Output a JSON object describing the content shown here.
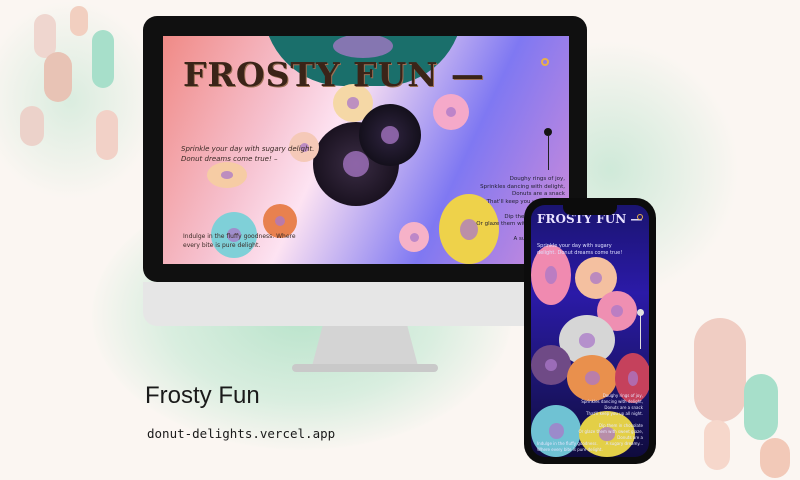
{
  "site": {
    "title": "FROSTY FUN —",
    "tagline": "Sprinkle your day with sugary delight. Donut dreams come true! –",
    "bottom_text": "Indulge in the fluffy goodness. Where every bite is pure delight.",
    "poem": "Doughy rings of joy,\nSprinkles dancing with delight,\nDonuts are a snack\nThat'll keep you up all night.\n\nDip them in chocolate\nOr glaze them with sweet glaze,\nDonuts are a\nA sugary dreamy..."
  },
  "mobile": {
    "title": "FROSTY FUN —",
    "tagline": "Sprinkle your day with sugary delight. Donut dreams come true!",
    "poem": "Doughy rings of joy,\nSprinkles dancing with delight,\nDonuts are a snack\nThat'll keep you up all night.\n\nDip them in chocolate\nOr glaze them with sweet glaze,\nDonuts are a\nA sugary dreamy...",
    "bottom_text": "Indulge in the fluffy goodness. Where every bite is pure delight."
  },
  "caption": {
    "title": "Frosty Fun",
    "url": "donut-delights.vercel.app"
  },
  "colors": {
    "accent_dot": "#e8b04a",
    "background": "#fbf6f2",
    "mint_wash": "#bfe3cc"
  }
}
